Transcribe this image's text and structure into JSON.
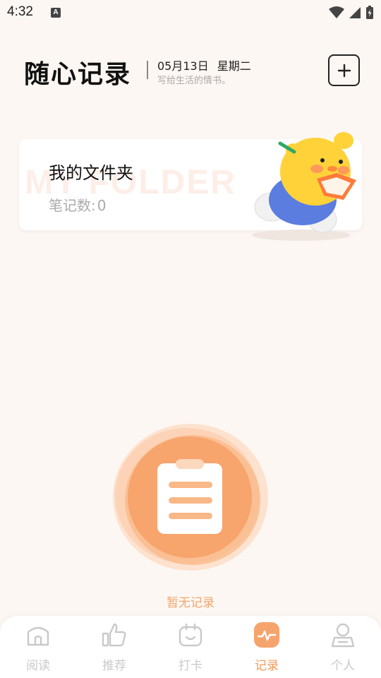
{
  "status_bar": {
    "time": "4:32",
    "notification_icon": "A"
  },
  "header": {
    "app_title": "随心记录",
    "date": "05月13日",
    "weekday": "星期二",
    "subtitle": "写给生活的情书。",
    "add_icon": "plus-icon"
  },
  "folder_card": {
    "background_text": "MY FOLDER",
    "name": "我的文件夹",
    "count_label": "笔记数:",
    "count_value": "0"
  },
  "empty_state": {
    "text": "暂无记录"
  },
  "tab_bar": {
    "tabs": [
      {
        "label": "阅读",
        "icon": "home-icon",
        "active": false
      },
      {
        "label": "推荐",
        "icon": "thumbs-up-icon",
        "active": false
      },
      {
        "label": "打卡",
        "icon": "smile-bag-icon",
        "active": false
      },
      {
        "label": "记录",
        "icon": "pulse-icon",
        "active": true
      },
      {
        "label": "个人",
        "icon": "person-icon",
        "active": false
      }
    ]
  },
  "colors": {
    "accent": "#f39a5a",
    "background": "#fdf7f3",
    "inactive": "#c9c9c9"
  }
}
